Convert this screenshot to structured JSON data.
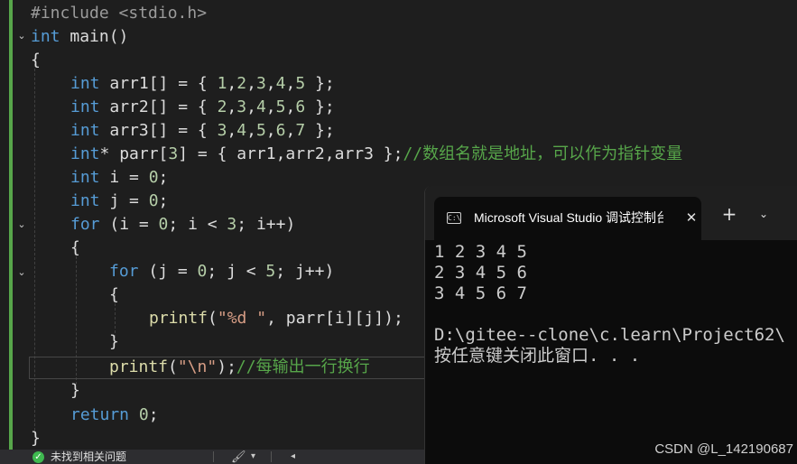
{
  "editor": {
    "lines": [
      {
        "t1": "#include <stdio.h>"
      },
      {
        "kw": "int",
        "t1": " main()"
      },
      {
        "t1": "{"
      },
      {
        "kw": "int",
        "t1": " arr1[] = { ",
        "n1": "1",
        "t2": ",",
        "n2": "2",
        "t3": ",",
        "n3": "3",
        "t4": ",",
        "n4": "4",
        "t5": ",",
        "n5": "5",
        "t6": " };"
      },
      {
        "kw": "int",
        "t1": " arr2[] = { ",
        "n1": "2",
        "t2": ",",
        "n2": "3",
        "t3": ",",
        "n3": "4",
        "t4": ",",
        "n4": "5",
        "t5": ",",
        "n5": "6",
        "t6": " };"
      },
      {
        "kw": "int",
        "t1": " arr3[] = { ",
        "n1": "3",
        "t2": ",",
        "n2": "4",
        "t3": ",",
        "n3": "5",
        "t4": ",",
        "n4": "6",
        "t5": ",",
        "n5": "7",
        "t6": " };"
      },
      {
        "kw": "int",
        "t1": "* parr[",
        "n1": "3",
        "t2": "] = { arr1,arr2,arr3 };",
        "cm": "//数组名就是地址，可以作为指针变量"
      },
      {
        "kw": "int",
        "t1": " i = ",
        "n1": "0",
        "t2": ";"
      },
      {
        "kw": "int",
        "t1": " j = ",
        "n1": "0",
        "t2": ";"
      },
      {
        "kw": "for",
        "t1": " (i = ",
        "n1": "0",
        "t2": "; i < ",
        "n2": "3",
        "t3": "; i++)"
      },
      {
        "t1": "{"
      },
      {
        "kw": "for",
        "t1": " (j = ",
        "n1": "0",
        "t2": "; j < ",
        "n2": "5",
        "t3": "; j++)"
      },
      {
        "t1": "{"
      },
      {
        "fn": "printf",
        "t1": "(",
        "str": "\"%d \"",
        "t2": ", parr[i][j]);"
      },
      {
        "t1": "}"
      },
      {
        "fn": "printf",
        "t1": "(",
        "str": "\"\\n\"",
        "t2": ");",
        "cm": "//每输出一行换行"
      },
      {
        "t1": "}"
      },
      {
        "kw": "return",
        "t1": " ",
        "n1": "0",
        "t2": ";"
      },
      {
        "t1": "}"
      }
    ],
    "fold_icon": "chevron-down-icon"
  },
  "status": {
    "message": "未找到相关问题",
    "ok_icon": "check-circle-icon",
    "brush_icon": "brush-icon",
    "ok_glyph": "✓",
    "brush_glyph": "🖌",
    "arrow_down": "▾",
    "arrow_left": "◂"
  },
  "terminal": {
    "tab_title": "Microsoft Visual Studio 调试控制台",
    "tab_icon_glyph": "C:\\",
    "close_glyph": "✕",
    "add_glyph": "+",
    "dropdown_glyph": "⌄",
    "output": [
      "1 2 3 4 5",
      "2 3 4 5 6",
      "3 4 5 6 7",
      "",
      "D:\\gitee--clone\\c.learn\\Project62\\",
      "按任意键关闭此窗口. . ."
    ]
  },
  "watermark": "CSDN @L_142190687",
  "colors": {
    "editor_bg": "#1e1e1e",
    "keyword": "#569cd6",
    "number": "#b5cea8",
    "string": "#d69d85",
    "comment": "#57a64a",
    "function": "#dcdcaa",
    "terminal_bg": "#0c0c0c"
  }
}
